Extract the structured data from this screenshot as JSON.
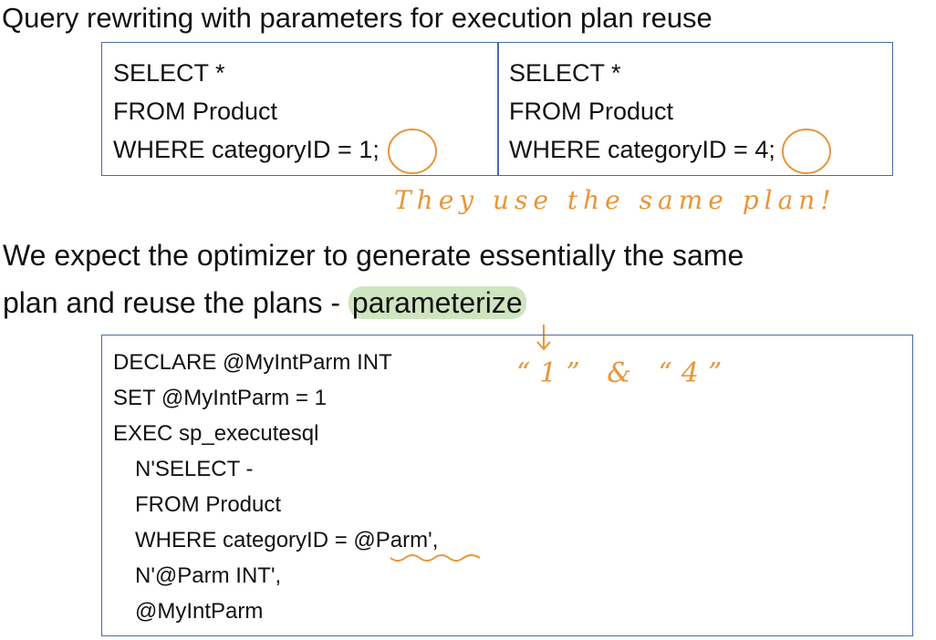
{
  "title": "Query rewriting with parameters for execution plan reuse",
  "query_left": [
    "SELECT *",
    "FROM Product",
    "WHERE categoryID = 1;"
  ],
  "query_right": [
    "SELECT *",
    "FROM Product",
    "WHERE categoryID = 4;"
  ],
  "annotation_same_plan": "They use the same plan!",
  "paragraph_line1": "We expect the optimizer to generate essentially the same",
  "paragraph_line2_prefix": "plan and reuse the plans - ",
  "paragraph_highlight": "parameterize",
  "annotation_values": "“1” & “4”",
  "code": {
    "line1": "DECLARE @MyIntParm INT",
    "line2": "SET @MyIntParm = 1",
    "line3": "EXEC sp_executesql",
    "line4": "N'SELECT -",
    "line5": "FROM Product",
    "line6_prefix": "WHERE categoryID = ",
    "line6_param": "@Parm'",
    "line6_suffix": ",",
    "line7": "N'@Parm INT',",
    "line8": "@MyIntParm"
  },
  "colors": {
    "ink": "#e8953a",
    "border": "#4a6aa5",
    "highlight": "#cfe5c0"
  }
}
